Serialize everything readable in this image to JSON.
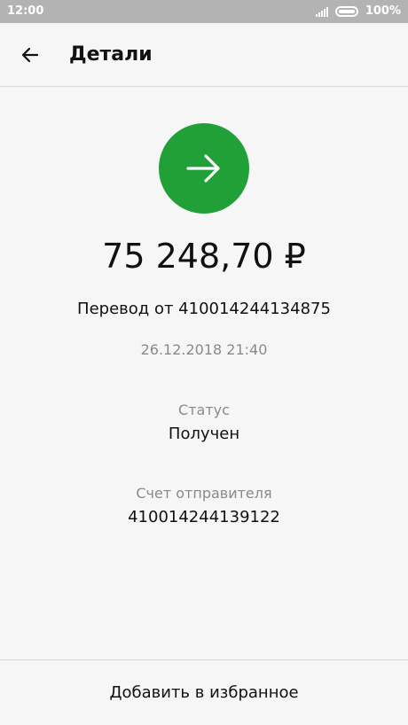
{
  "status_bar": {
    "time": "12:00",
    "battery": "100%"
  },
  "app_bar": {
    "back_icon": "arrow-left-icon",
    "title": "Детали"
  },
  "transaction": {
    "icon": "arrow-right-icon",
    "icon_color": "#21a038",
    "amount": "75 248,70 ₽",
    "description": "Перевод от 410014244134875",
    "datetime": "26.12.2018 21:40",
    "status_label": "Статус",
    "status_value": "Получен",
    "sender_label": "Счет отправителя",
    "sender_value": "410014244139122"
  },
  "actions": {
    "favorite_label": "Добавить в избранное"
  }
}
